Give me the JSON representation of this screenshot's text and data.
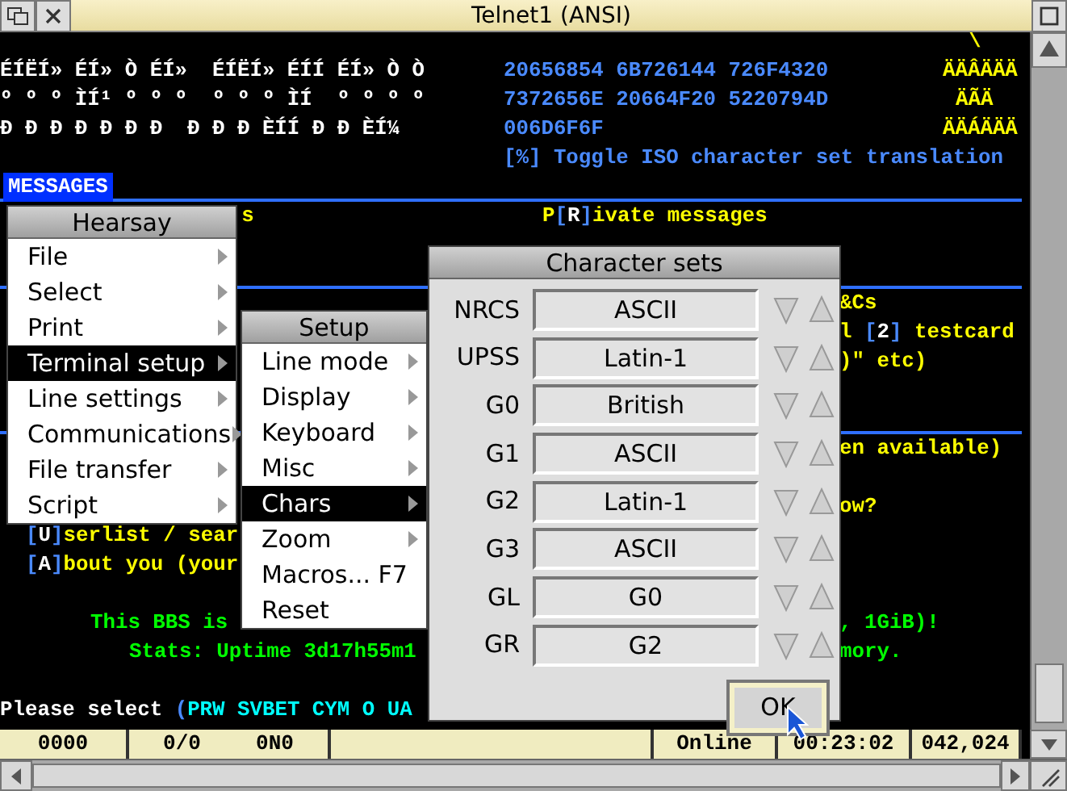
{
  "window": {
    "title": "Telnet1 (ANSI)"
  },
  "terminal": {
    "lines": [
      {
        "runs": [
          {
            "kind": "text",
            "spans": [
              {
                "text": "\\",
                "color": "#ffff00"
              }
            ]
          }
        ]
      },
      {
        "runs": [
          {
            "kind": "text",
            "spans": [
              {
                "text": "ÉÍËÍ» ÉÍ» Ò ÉÍ»  ÉÍËÍ» ÉÍÍ ÉÍ» Ò Ò",
                "color": "#ffffff"
              }
            ]
          },
          {
            "kind": "text",
            "spans": [
              {
                "text": "20656854 6B726144 726F4320",
                "color": "#4a8aff"
              }
            ]
          },
          {
            "kind": "text",
            "spans": [
              {
                "text": "ÄÄÂÄÄÄ",
                "color": "#ffff00"
              }
            ]
          }
        ]
      },
      {
        "runs": [
          {
            "kind": "text",
            "spans": [
              {
                "text": "º º º ÌÍ¹ º º º  º º º ÌÍ  º º º º",
                "color": "#ffffff"
              }
            ]
          },
          {
            "kind": "text",
            "spans": [
              {
                "text": "7372656E 20664F20 5220794D",
                "color": "#4a8aff"
              }
            ]
          },
          {
            "kind": "text",
            "spans": [
              {
                "text": "ÄÃÄ",
                "color": "#ffff00"
              }
            ]
          }
        ]
      },
      {
        "runs": [
          {
            "kind": "text",
            "spans": [
              {
                "text": "Ð Ð Ð Ð Ð Ð Ð  Ð Ð Ð ÈÍÍ Ð Ð ÈÍ¼",
                "color": "#ffffff"
              }
            ]
          },
          {
            "kind": "text",
            "spans": [
              {
                "text": "006D6F6F",
                "color": "#4a8aff"
              }
            ]
          },
          {
            "kind": "text",
            "spans": [
              {
                "text": "ÄÄÁÄÄÄ",
                "color": "#ffff00"
              }
            ]
          }
        ]
      },
      {
        "runs": [
          {
            "kind": "text",
            "spans": [
              {
                "text": "[%] Toggle ISO character set translation",
                "color": "#4a8aff"
              }
            ]
          }
        ]
      },
      {
        "runs": [
          {
            "kind": "heading",
            "spans": [
              {
                "text": "MESSAGES",
                "color": "#ffffff"
              }
            ]
          }
        ]
      },
      {
        "runs": [
          {
            "kind": "text",
            "spans": [
              {
                "text": "s",
                "color": "#ffff00"
              }
            ]
          },
          {
            "kind": "text",
            "spans": [
              {
                "text": "P",
                "color": "#ffff00"
              },
              {
                "text": "[",
                "color": "#4a8aff"
              },
              {
                "text": "R",
                "color": "#ffffff"
              },
              {
                "text": "]",
                "color": "#4a8aff"
              },
              {
                "text": "ivate messages",
                "color": "#ffff00"
              }
            ]
          }
        ]
      },
      {
        "runs": [
          {
            "kind": "text",
            "spans": [
              {
                "text": "&Cs",
                "color": "#ffff00"
              }
            ]
          }
        ]
      },
      {
        "runs": [
          {
            "kind": "text",
            "spans": [
              {
                "text": "l ",
                "color": "#ffff00"
              },
              {
                "text": "[",
                "color": "#4a8aff"
              },
              {
                "text": "2",
                "color": "#ffffff"
              },
              {
                "text": "] ",
                "color": "#4a8aff"
              },
              {
                "text": "testcard",
                "color": "#ffff00"
              }
            ]
          }
        ]
      },
      {
        "runs": [
          {
            "kind": "text",
            "spans": [
              {
                "text": ")\" etc)",
                "color": "#ffff00"
              }
            ]
          }
        ]
      },
      {
        "runs": [
          {
            "kind": "text",
            "spans": [
              {
                "text": "en available)",
                "color": "#ffff00"
              }
            ]
          }
        ]
      },
      {
        "runs": [
          {
            "kind": "text",
            "spans": [
              {
                "text": "ow?",
                "color": "#ffff00"
              }
            ]
          }
        ]
      },
      {
        "runs": [
          {
            "kind": "text",
            "spans": [
              {
                "text": "[",
                "color": "#4a8aff"
              },
              {
                "text": "U",
                "color": "#ffffff"
              },
              {
                "text": "]",
                "color": "#4a8aff"
              },
              {
                "text": "serlist / sear",
                "color": "#ffff00"
              }
            ]
          }
        ]
      },
      {
        "runs": [
          {
            "kind": "text",
            "spans": [
              {
                "text": "[",
                "color": "#4a8aff"
              },
              {
                "text": "A",
                "color": "#ffffff"
              },
              {
                "text": "]",
                "color": "#4a8aff"
              },
              {
                "text": "bout you (your",
                "color": "#ffff00"
              }
            ]
          }
        ]
      },
      {
        "runs": [
          {
            "kind": "text",
            "spans": [
              {
                "text": "This BBS is",
                "color": "#00ff00"
              }
            ]
          },
          {
            "kind": "text",
            "spans": [
              {
                "text": ", 1GiB)!",
                "color": "#00ff00"
              }
            ]
          }
        ]
      },
      {
        "runs": [
          {
            "kind": "text",
            "spans": [
              {
                "text": "Stats: Uptime 3d17h55m1",
                "color": "#00ff00"
              }
            ]
          },
          {
            "kind": "text",
            "spans": [
              {
                "text": "mory.",
                "color": "#00ff00"
              }
            ]
          }
        ]
      },
      {
        "runs": [
          {
            "kind": "text",
            "spans": [
              {
                "text": "Please select ",
                "color": "#ffffff"
              },
              {
                "text": "(",
                "color": "#4a8aff"
              },
              {
                "text": "PRW SVBET CYM O UA",
                "color": "#00ffff"
              }
            ]
          }
        ]
      }
    ]
  },
  "menus": [
    {
      "title": "Hearsay",
      "items": [
        {
          "label": "File",
          "submenu": true,
          "selected": false
        },
        {
          "label": "Select",
          "submenu": true,
          "selected": false
        },
        {
          "label": "Print",
          "submenu": true,
          "selected": false
        },
        {
          "label": "Terminal setup",
          "submenu": true,
          "selected": true
        },
        {
          "label": "Line settings",
          "submenu": true,
          "selected": false
        },
        {
          "label": "Communications",
          "submenu": true,
          "selected": false
        },
        {
          "label": "File transfer",
          "submenu": true,
          "selected": false
        },
        {
          "label": "Script",
          "submenu": true,
          "selected": false
        }
      ]
    },
    {
      "title": "Setup",
      "items": [
        {
          "label": "Line mode",
          "submenu": true,
          "selected": false
        },
        {
          "label": "Display",
          "submenu": true,
          "selected": false
        },
        {
          "label": "Keyboard",
          "submenu": true,
          "selected": false
        },
        {
          "label": "Misc",
          "submenu": true,
          "selected": false
        },
        {
          "label": "Chars",
          "submenu": true,
          "selected": true
        },
        {
          "label": "Zoom",
          "submenu": true,
          "selected": false
        },
        {
          "label": "Macros...",
          "shortcut": "F7",
          "submenu": false,
          "selected": false
        },
        {
          "label": "Reset",
          "submenu": false,
          "selected": false
        }
      ]
    }
  ],
  "dialog": {
    "title": "Character sets",
    "rows": [
      {
        "label": "NRCS",
        "value": "ASCII"
      },
      {
        "label": "UPSS",
        "value": "Latin-1"
      },
      {
        "label": "G0",
        "value": "British"
      },
      {
        "label": "G1",
        "value": "ASCII"
      },
      {
        "label": "G2",
        "value": "Latin-1"
      },
      {
        "label": "G3",
        "value": "ASCII"
      },
      {
        "label": "GL",
        "value": "G0"
      },
      {
        "label": "GR",
        "value": "G2"
      }
    ],
    "button": {
      "label": "OK",
      "default": true
    }
  },
  "status_bar": {
    "cells": [
      "0000",
      "0/0",
      "0N0",
      "Online",
      "00:23:02",
      "042,024"
    ]
  }
}
